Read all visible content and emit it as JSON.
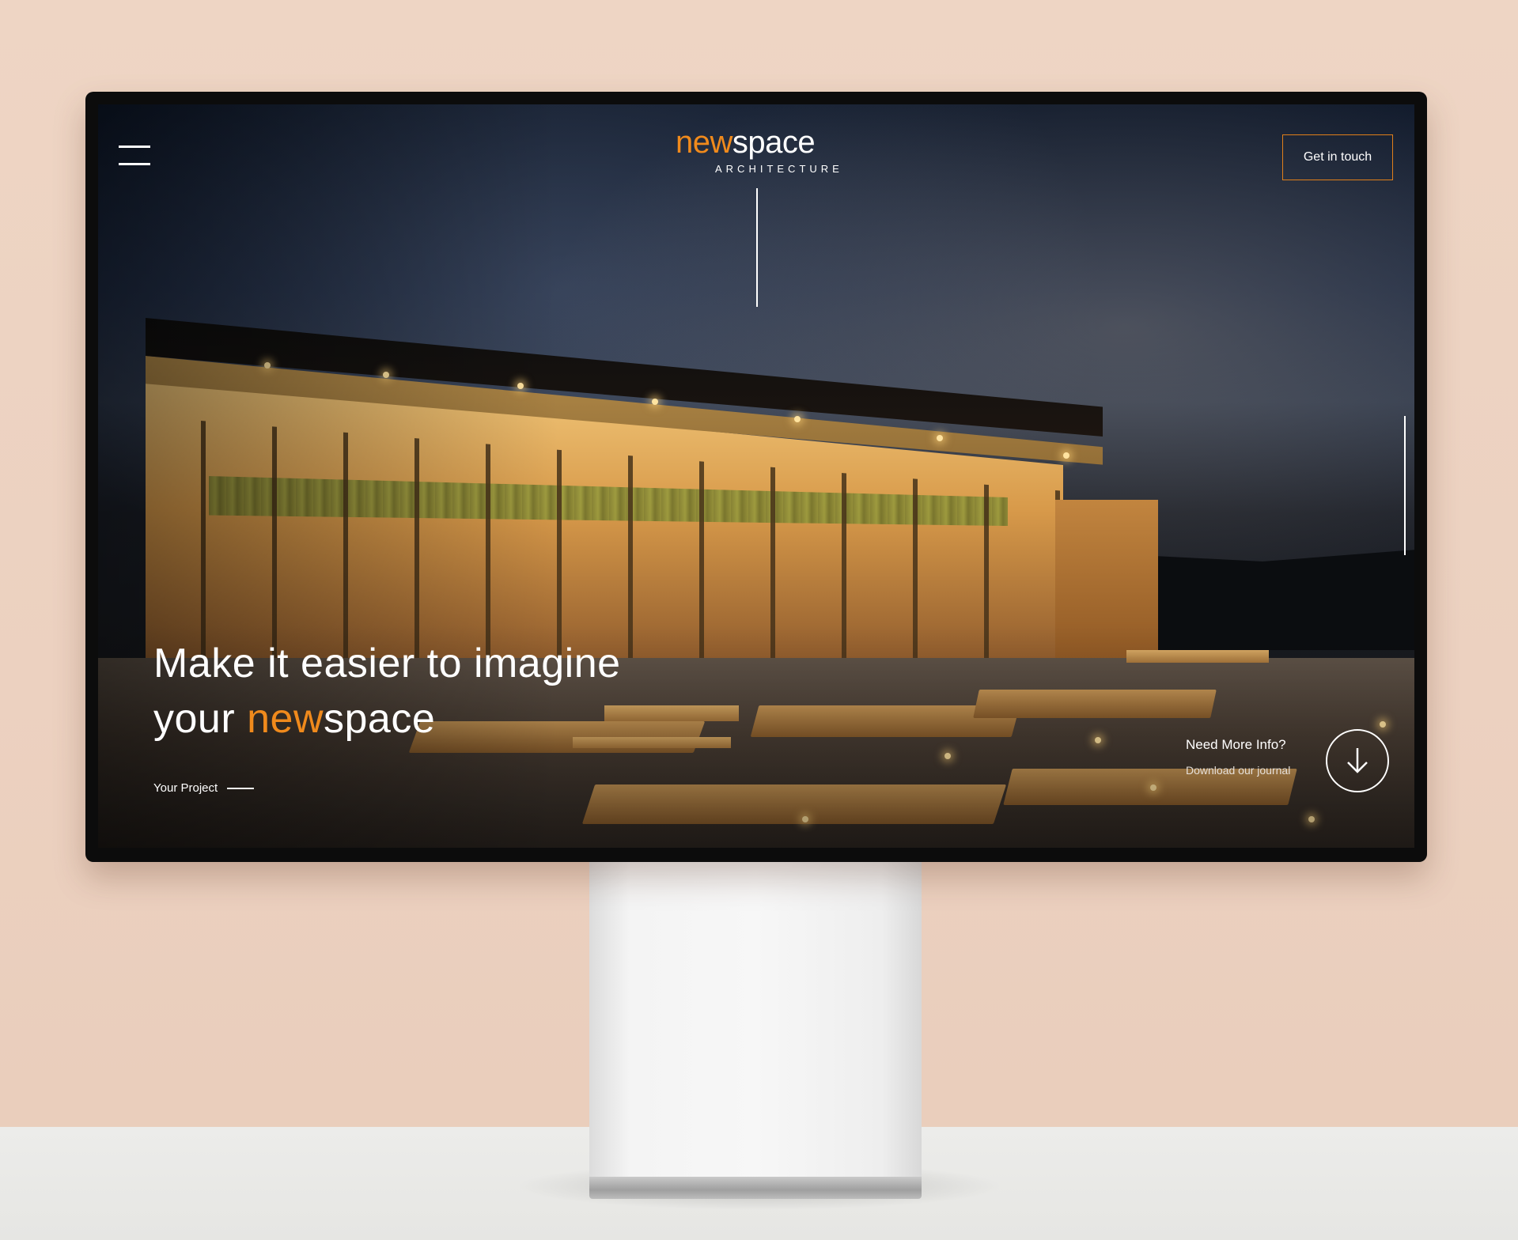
{
  "header": {
    "logo_primary_accent": "new",
    "logo_primary_rest": "space",
    "logo_subtitle": "ARCHITECTURE",
    "cta_label": "Get in touch"
  },
  "hero": {
    "headline_line1": "Make it easier to imagine",
    "headline_line2_prefix": "your ",
    "headline_line2_accent": "new",
    "headline_line2_rest": "space",
    "secondary_link": "Your Project"
  },
  "info": {
    "title": "Need More Info?",
    "subtitle": "Download our journal"
  },
  "icons": {
    "menu": "hamburger-menu-icon",
    "download": "arrow-down-icon"
  },
  "colors": {
    "accent": "#f08a1c",
    "button_border": "#e07f1a",
    "text": "#ffffff",
    "backdrop": "#ecd1c0"
  }
}
